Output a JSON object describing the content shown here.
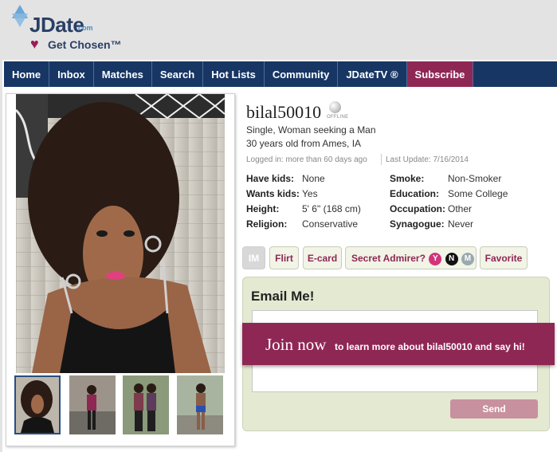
{
  "brand": {
    "name": "JDate",
    "domain_suffix": "com",
    "tagline": "Get Chosen™",
    "primary_color": "#173664",
    "accent_color": "#8f2755"
  },
  "nav": {
    "items": [
      {
        "label": "Home"
      },
      {
        "label": "Inbox"
      },
      {
        "label": "Matches"
      },
      {
        "label": "Search"
      },
      {
        "label": "Hot Lists"
      },
      {
        "label": "Community"
      },
      {
        "label": "JDateTV ®"
      },
      {
        "label": "Subscribe",
        "highlight": true
      }
    ]
  },
  "profile": {
    "username": "bilal50010",
    "status": "OFFLINE",
    "headline": "Single, Woman seeking a Man",
    "location": "30 years old from Ames, IA",
    "logged_in": "Logged in: more than 60 days ago",
    "last_update": "Last Update: 7/16/2014",
    "attributes_left": [
      {
        "key": "Have kids:",
        "value": "None"
      },
      {
        "key": "Wants kids:",
        "value": "Yes"
      },
      {
        "key": "Height:",
        "value": "5' 6\" (168 cm)"
      },
      {
        "key": "Religion:",
        "value": "Conservative"
      }
    ],
    "attributes_right": [
      {
        "key": "Smoke:",
        "value": "Non-Smoker"
      },
      {
        "key": "Education:",
        "value": "Some College"
      },
      {
        "key": "Occupation:",
        "value": "Other"
      },
      {
        "key": "Synagogue:",
        "value": "Never"
      }
    ]
  },
  "actions": {
    "im": "IM",
    "flirt": "Flirt",
    "ecard": "E-card",
    "secret_admirer": "Secret Admirer?",
    "admirer_yes": "Y",
    "admirer_no": "N",
    "admirer_maybe": "M",
    "favorite": "Favorite"
  },
  "email": {
    "title": "Email Me!",
    "send_label": "Send"
  },
  "join_banner": {
    "big": "Join now",
    "small": "to learn more about bilal50010 and say hi!"
  },
  "photos": {
    "count": 4,
    "selected_index": 0
  }
}
